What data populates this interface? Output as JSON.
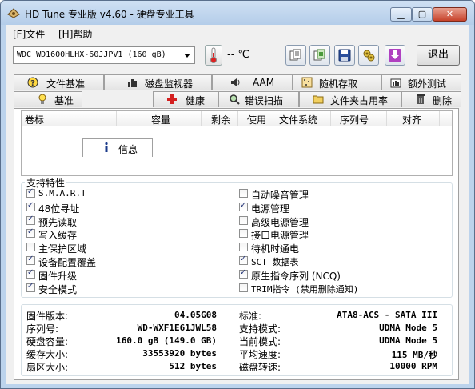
{
  "window": {
    "title": "HD Tune 专业版 v4.60 - 硬盘专业工具"
  },
  "menu": [
    {
      "label": "[F]文件"
    },
    {
      "label": "[H]帮助"
    }
  ],
  "toolbar": {
    "drive": "WDC WD1600HLHX-60JJPV1 (160 gB)",
    "temperature": "-- ℃",
    "exit_label": "退出",
    "icons": [
      "copy-info-icon",
      "copy-screen-icon",
      "save-icon",
      "options-icon",
      "download-icon"
    ]
  },
  "tabs_row1": [
    {
      "label": "文件基准",
      "icon": "file-benchmark-icon"
    },
    {
      "label": "磁盘监视器",
      "icon": "disk-monitor-icon"
    },
    {
      "label": "AAM",
      "icon": "speaker-icon"
    },
    {
      "label": "随机存取",
      "icon": "random-access-icon"
    },
    {
      "label": "额外测试",
      "icon": "extra-tests-icon"
    }
  ],
  "tabs_row2": [
    {
      "label": "基准",
      "icon": "benchmark-icon"
    },
    {
      "label": "信息",
      "icon": "info-icon"
    },
    {
      "label": "健康",
      "icon": "health-icon"
    },
    {
      "label": "错误扫描",
      "icon": "error-scan-icon"
    },
    {
      "label": "文件夹占用率",
      "icon": "folder-usage-icon"
    },
    {
      "label": "删除",
      "icon": "erase-icon"
    }
  ],
  "active_tab": "信息",
  "volumes": {
    "columns": [
      "卷标",
      "容量",
      "剩余",
      "使用",
      "文件系统",
      "序列号",
      "对齐"
    ],
    "rows": []
  },
  "features": {
    "title": "支持特性",
    "left": [
      {
        "label": "S.M.A.R.T",
        "checked": true
      },
      {
        "label": "48位寻址",
        "checked": true
      },
      {
        "label": "预先读取",
        "checked": true
      },
      {
        "label": "写入缓存",
        "checked": true
      },
      {
        "label": "主保护区域",
        "checked": false
      },
      {
        "label": "设备配置覆盖",
        "checked": true
      },
      {
        "label": "固件升级",
        "checked": true
      },
      {
        "label": "安全模式",
        "checked": true
      }
    ],
    "right": [
      {
        "label": "自动噪音管理",
        "checked": false
      },
      {
        "label": "电源管理",
        "checked": true
      },
      {
        "label": "高级电源管理",
        "checked": false
      },
      {
        "label": "接口电源管理",
        "checked": false
      },
      {
        "label": "待机时通电",
        "checked": false
      },
      {
        "label": "SCT 数据表",
        "checked": true
      },
      {
        "label": "原生指令序列 (NCQ)",
        "checked": true
      },
      {
        "label": "TRIM指令 (禁用删除通知)",
        "checked": false
      }
    ]
  },
  "info": {
    "left": [
      {
        "key": "固件版本:",
        "value": "04.05G08"
      },
      {
        "key": "序列号:",
        "value": "WD-WXF1E61JWL58"
      },
      {
        "key": "硬盘容量:",
        "value": "160.0 gB (149.0 GB)"
      },
      {
        "key": "缓存大小:",
        "value": "33553920 bytes"
      },
      {
        "key": "扇区大小:",
        "value": "512 bytes"
      }
    ],
    "right": [
      {
        "key": "标准:",
        "value": "ATA8-ACS - SATA III"
      },
      {
        "key": "支持模式:",
        "value": "UDMA Mode 5"
      },
      {
        "key": "当前模式:",
        "value": "UDMA Mode 5"
      },
      {
        "key": "平均速度:",
        "value": "115 MB/秒"
      },
      {
        "key": "磁盘转速:",
        "value": "10000 RPM"
      }
    ]
  }
}
